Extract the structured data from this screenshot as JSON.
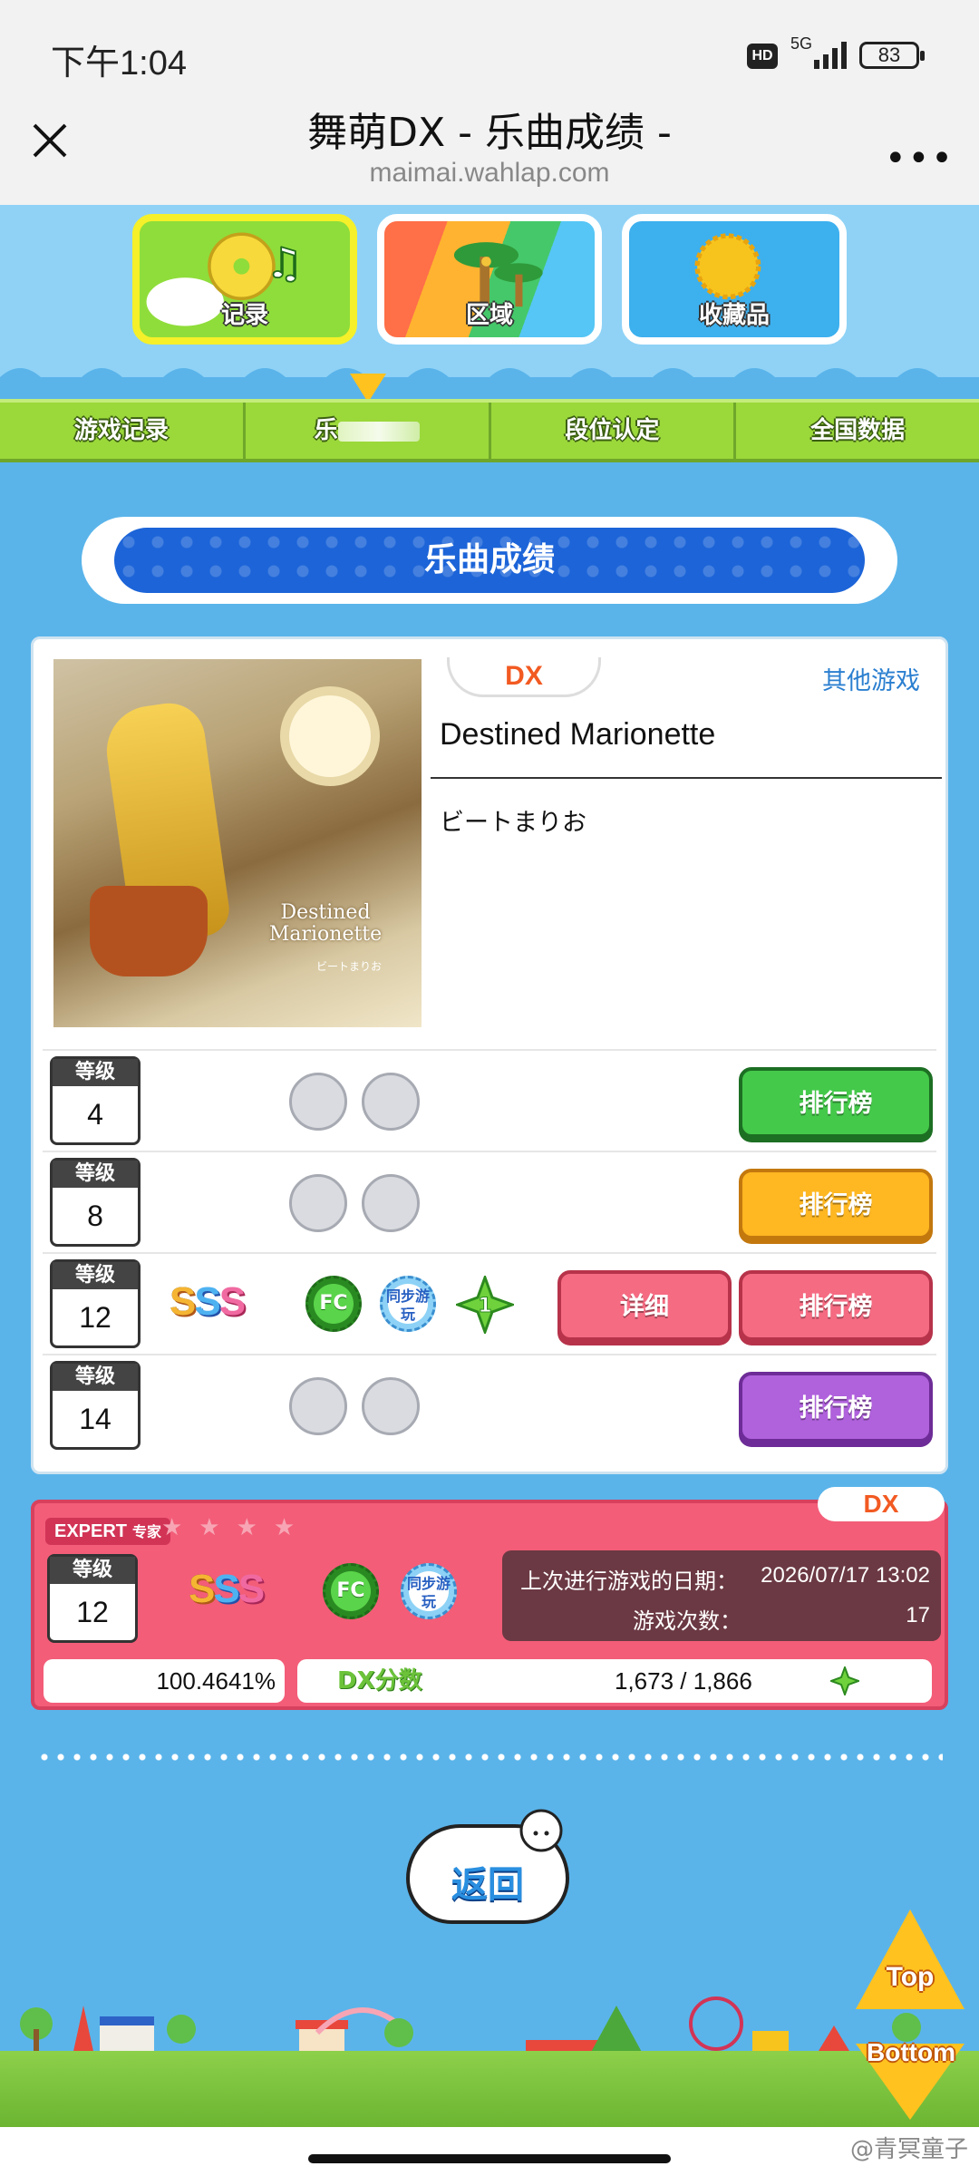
{
  "status_bar": {
    "time": "下午1:04",
    "hd": "HD",
    "network": "5G",
    "battery": "83"
  },
  "titlebar": {
    "title": "舞萌DX - 乐曲成绩 -",
    "domain": "maimai.wahlap.com"
  },
  "nav_tabs": [
    {
      "label": "记录"
    },
    {
      "label": "区域"
    },
    {
      "label": "收藏品"
    }
  ],
  "subnav": {
    "items": [
      "游戏记录",
      "乐",
      "段位认定",
      "全国数据"
    ]
  },
  "section_title": "乐曲成绩",
  "song": {
    "badge": "DX",
    "other_game_link": "其他游戏",
    "title": "Destined Marionette",
    "artist": "ビートまりお",
    "jacket_text": "Destined Marionette",
    "jacket_artist": "ビートまりお"
  },
  "difficulties": [
    {
      "level_label": "等级",
      "level": "4",
      "rank_button": "排行榜",
      "color": "#44c94a"
    },
    {
      "level_label": "等级",
      "level": "8",
      "rank_button": "排行榜",
      "color": "#ffb722"
    },
    {
      "level_label": "等级",
      "level": "12",
      "rank": "SSS",
      "fc": "FC",
      "sync": "同步游玩",
      "dx_star": "1",
      "detail_button": "详细",
      "rank_button": "排行榜",
      "color": "#f56b82"
    },
    {
      "level_label": "等级",
      "level": "14",
      "rank_button": "排行榜",
      "color": "#b061dc"
    }
  ],
  "detail": {
    "difficulty_name": "EXPERT",
    "difficulty_name_cn": "专家",
    "badge": "DX",
    "level_label": "等级",
    "level": "12",
    "rank": "SSS",
    "fc": "FC",
    "sync": "同步游玩",
    "last_played_label": "上次进行游戏的日期：",
    "last_played_value": "2026/07/17 13:02",
    "play_count_label": "游戏次数：",
    "play_count_value": "17",
    "achievement": "100.4641%",
    "dx_score_label": "DX分数",
    "dx_score_value": "1,673 / 1,866"
  },
  "back_button": "返回",
  "top_button": "Top",
  "bottom_button": "Bottom",
  "watermark": "@青冥童子"
}
